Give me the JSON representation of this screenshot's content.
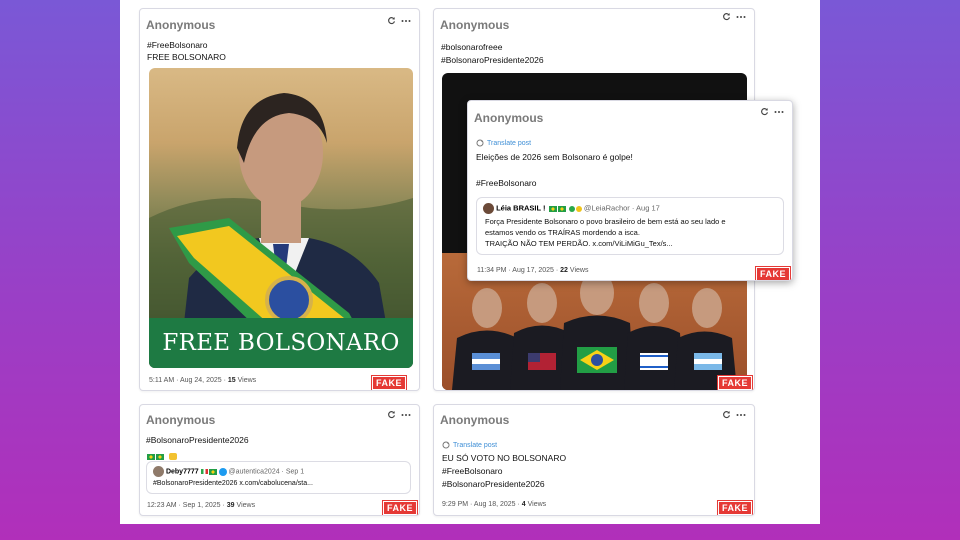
{
  "post1": {
    "author": "Anonymous",
    "hashtag": "#FreeBolsonaro",
    "text": "FREE BOLSONARO",
    "banner_text": "FREE BOLSONARO",
    "meta_time": "5:11 AM · Aug 24, 2025 · ",
    "meta_views": "15",
    "meta_views_label": " Views",
    "badge": "FAKE"
  },
  "post2": {
    "author": "Anonymous",
    "hashtag1": "#bolsonarofreee",
    "hashtag2": "#BolsonaroPresidente2026",
    "badge": "FAKE"
  },
  "post3": {
    "author": "Anonymous",
    "translate": "Translate post",
    "text": "Eleições de 2026 sem Bolsonaro é golpe!",
    "hashtag": "#FreeBolsonaro",
    "quote": {
      "name": "Léia BRASIL !",
      "handle": "@LeiaRachor · Aug 17",
      "line1": "Força Presidente Bolsonaro o povo brasileiro de bem está ao seu lado e",
      "line2": "estamos vendo os TRAÍRAS mordendo a isca.",
      "line3": "TRAIÇÃO NÃO TEM PERDÃO. x.com/ViLiMiGu_Tex/s..."
    },
    "meta_time": "11:34 PM · Aug 17, 2025 · ",
    "meta_views": "22",
    "meta_views_label": " Views",
    "badge": "FAKE"
  },
  "post4": {
    "author": "Anonymous",
    "hashtag": "#BolsonaroPresidente2026",
    "quote": {
      "name": "Deby7777",
      "handle": "@autentica2024 · Sep 1",
      "line1": "#BolsonaroPresidente2026 x.com/cabolucena/sta..."
    },
    "meta_time": "12:23 AM · Sep 1, 2025 · ",
    "meta_views": "39",
    "meta_views_label": " Views",
    "badge": "FAKE"
  },
  "post5": {
    "author": "Anonymous",
    "translate": "Translate post",
    "line1": "EU SÓ VOTO NO BOLSONARO",
    "hashtag1": "#FreeBolsonaro",
    "hashtag2": "#BolsonaroPresidente2026",
    "meta_time": "9:29 PM · Aug 18, 2025 · ",
    "meta_views": "4",
    "meta_views_label": " Views",
    "badge": "FAKE"
  },
  "colors": {
    "accent": "#3f8fd6",
    "fake_badge": "#e53935",
    "background_top": "#7a58d6",
    "background_bottom": "#b12fba"
  },
  "icons": [
    "refresh-icon",
    "more-icon",
    "translate-icon",
    "verified-icon"
  ]
}
